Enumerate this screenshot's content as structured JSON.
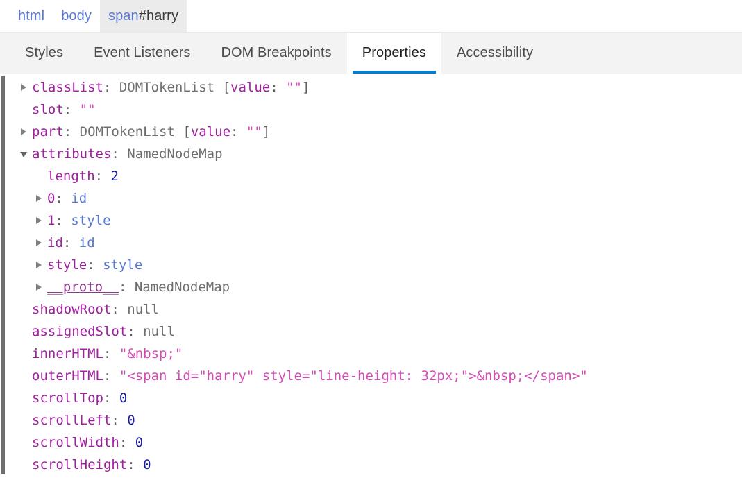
{
  "breadcrumb": {
    "items": [
      {
        "label": "html",
        "id_suffix": "",
        "selected": false
      },
      {
        "label": "body",
        "id_suffix": "",
        "selected": false
      },
      {
        "label": "span",
        "id_suffix": "#harry",
        "selected": true
      }
    ]
  },
  "tabs": [
    {
      "label": "Styles",
      "active": false
    },
    {
      "label": "Event Listeners",
      "active": false
    },
    {
      "label": "DOM Breakpoints",
      "active": false
    },
    {
      "label": "Properties",
      "active": true
    },
    {
      "label": "Accessibility",
      "active": false
    }
  ],
  "colors": {
    "accent_underline": "#0b7ad1",
    "breadcrumb_link": "#5a79d4",
    "property_name": "#a020a0",
    "string_value": "#d64ab5",
    "number_value": "#1a1aa6",
    "class_name": "#6e6e6e",
    "object_ref": "#5a79d4",
    "tab_bar_bg": "#f3f3f3",
    "selected_crumb_bg": "#ebebeb"
  },
  "properties": [
    {
      "twisty": "collapsed",
      "indent": 0,
      "name": "classList",
      "colon": ": ",
      "parts": [
        {
          "text": "DOMTokenList ",
          "cls": "v-class"
        },
        {
          "text": "[",
          "cls": "k-punct"
        },
        {
          "text": "value",
          "cls": "v-attr"
        },
        {
          "text": ": ",
          "cls": "k-punct"
        },
        {
          "text": "\"\"",
          "cls": "v-string"
        },
        {
          "text": "]",
          "cls": "k-punct"
        }
      ]
    },
    {
      "twisty": "none",
      "indent": 0,
      "name": "slot",
      "colon": ": ",
      "parts": [
        {
          "text": "\"\"",
          "cls": "v-string"
        }
      ]
    },
    {
      "twisty": "collapsed",
      "indent": 0,
      "name": "part",
      "colon": ": ",
      "parts": [
        {
          "text": "DOMTokenList ",
          "cls": "v-class"
        },
        {
          "text": "[",
          "cls": "k-punct"
        },
        {
          "text": "value",
          "cls": "v-attr"
        },
        {
          "text": ": ",
          "cls": "k-punct"
        },
        {
          "text": "\"\"",
          "cls": "v-string"
        },
        {
          "text": "]",
          "cls": "k-punct"
        }
      ]
    },
    {
      "twisty": "expanded",
      "indent": 0,
      "name": "attributes",
      "colon": ": ",
      "parts": [
        {
          "text": "NamedNodeMap",
          "cls": "v-class"
        }
      ]
    },
    {
      "twisty": "none",
      "indent": 1,
      "name": "length",
      "colon": ": ",
      "parts": [
        {
          "text": "2",
          "cls": "v-number"
        }
      ]
    },
    {
      "twisty": "collapsed",
      "indent": 1,
      "name": "0",
      "colon": ": ",
      "parts": [
        {
          "text": "id",
          "cls": "v-obj"
        }
      ]
    },
    {
      "twisty": "collapsed",
      "indent": 1,
      "name": "1",
      "colon": ": ",
      "parts": [
        {
          "text": "style",
          "cls": "v-obj"
        }
      ]
    },
    {
      "twisty": "collapsed",
      "indent": 1,
      "name": "id",
      "colon": ": ",
      "parts": [
        {
          "text": "id",
          "cls": "v-obj"
        }
      ]
    },
    {
      "twisty": "collapsed",
      "indent": 1,
      "name": "style",
      "colon": ": ",
      "parts": [
        {
          "text": "style",
          "cls": "v-obj"
        }
      ]
    },
    {
      "twisty": "collapsed",
      "indent": 1,
      "name": "__proto__",
      "name_cls": "k-proto",
      "colon": ": ",
      "parts": [
        {
          "text": "NamedNodeMap",
          "cls": "v-class"
        }
      ]
    },
    {
      "twisty": "none",
      "indent": 0,
      "name": "shadowRoot",
      "colon": ": ",
      "parts": [
        {
          "text": "null",
          "cls": "v-null"
        }
      ]
    },
    {
      "twisty": "none",
      "indent": 0,
      "name": "assignedSlot",
      "colon": ": ",
      "parts": [
        {
          "text": "null",
          "cls": "v-null"
        }
      ]
    },
    {
      "twisty": "none",
      "indent": 0,
      "name": "innerHTML",
      "colon": ": ",
      "parts": [
        {
          "text": "\"&nbsp;\"",
          "cls": "v-string"
        }
      ]
    },
    {
      "twisty": "none",
      "indent": 0,
      "name": "outerHTML",
      "colon": ": ",
      "parts": [
        {
          "text": "\"<span id=\"harry\" style=\"line-height: 32px;\">&nbsp;</span>\"",
          "cls": "v-string"
        }
      ]
    },
    {
      "twisty": "none",
      "indent": 0,
      "name": "scrollTop",
      "colon": ": ",
      "parts": [
        {
          "text": "0",
          "cls": "v-number"
        }
      ]
    },
    {
      "twisty": "none",
      "indent": 0,
      "name": "scrollLeft",
      "colon": ": ",
      "parts": [
        {
          "text": "0",
          "cls": "v-number"
        }
      ]
    },
    {
      "twisty": "none",
      "indent": 0,
      "name": "scrollWidth",
      "colon": ": ",
      "parts": [
        {
          "text": "0",
          "cls": "v-number"
        }
      ]
    },
    {
      "twisty": "none",
      "indent": 0,
      "name": "scrollHeight",
      "colon": ": ",
      "parts": [
        {
          "text": "0",
          "cls": "v-number"
        }
      ]
    }
  ]
}
